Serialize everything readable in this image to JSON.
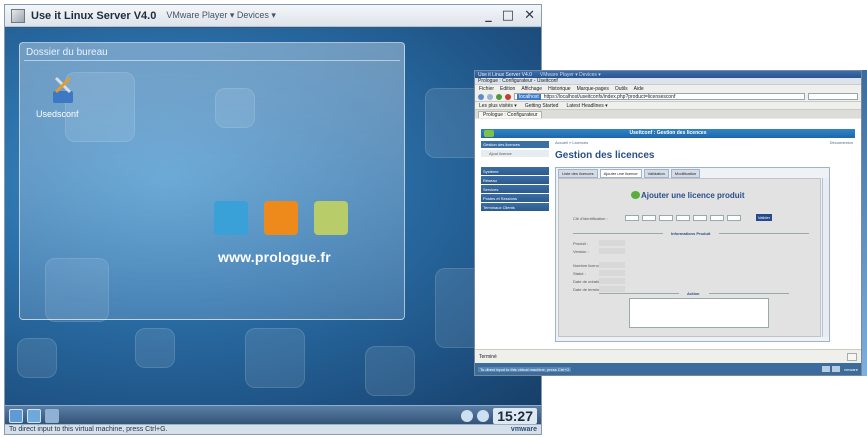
{
  "vmware": {
    "title": "Use it Linux Server V4.0",
    "menu": "VMware Player ▾ Devices ▾",
    "controls": {
      "minimize": "_",
      "maximize": "□",
      "close": "✕"
    },
    "folder_view_title": "Dossier du bureau",
    "desktop_icon_label": "Usedsconf",
    "site_url": "www.prologue.fr",
    "clock": "15:27",
    "status_text": "To direct input to this virtual machine, press Ctrl+G.",
    "brand": "vmware"
  },
  "firefox": {
    "window_title": "Use it Linux Server V4.0",
    "window_title_menu": "VMware Player ▾ Devices ▾",
    "tab_title": "Prologue : Configurateur - Useitconf",
    "menu": [
      "Fichier",
      "Edition",
      "Affichage",
      "Historique",
      "Marque-pages",
      "Outils",
      "Aide"
    ],
    "url_host": "localhost",
    "url": "https://localhost/useitconfs/index.php?product=licensesconf",
    "bookmarks": [
      "Les plus visités ▾",
      "Getting Started",
      "Latest Headlines ▾"
    ],
    "tab_label": "Prologue : Configurateur",
    "status_text": "Terminé",
    "vm_status_text": "To direct input to this virtual machine, press Ctrl+G",
    "vm_brand": "vmware"
  },
  "app": {
    "header_title": "Useitconf : Gestion des licences",
    "breadcrumb": "Accueil » Licences",
    "logout": "Déconnexion",
    "sidebar_head": "Gestion des licences",
    "sidebar_sub": "Ajout licence",
    "sidebar_items": [
      "Système",
      "Réseau",
      "Services",
      "Postes et Sessions",
      "Terminaux Clients"
    ],
    "page_title": "Gestion des licences",
    "tabs": [
      "Liste des licences",
      "Ajouter une licence",
      "Validation",
      "Modification"
    ],
    "add_title": "Ajouter une licence produit",
    "key_label": "Clé d'identification :",
    "ok_label": "Valider",
    "section_info": "Informations Produit",
    "fields": [
      "Produit :",
      "Version :",
      "Nombre licences :",
      "Statut :",
      "Date de création :",
      "Date de terminaison :"
    ],
    "section_action": "Action"
  }
}
